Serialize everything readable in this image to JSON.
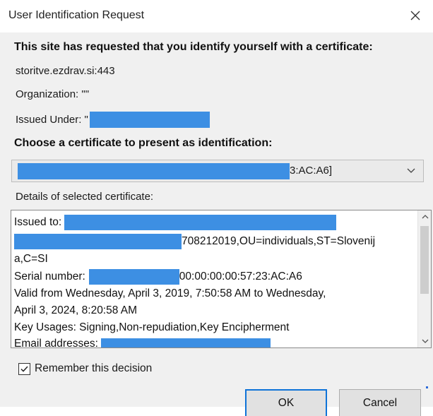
{
  "window": {
    "title": "User Identification Request",
    "close_glyph": "✕"
  },
  "header": {
    "requested_text": "This site has requested that you identify yourself with a certificate:",
    "site": "storitve.ezdrav.si:443",
    "organization_label": "Organization: \"\"",
    "issued_under_label": "Issued Under: \""
  },
  "choose": {
    "label": "Choose a certificate to present as identification:",
    "selected_suffix": "3:AC:A6]"
  },
  "details": {
    "label": "Details of selected certificate:",
    "issued_to_label": "Issued to:",
    "line2_suffix": "708212019,OU=individuals,ST=Slovenij",
    "line3": "a,C=SI",
    "serial_label": "Serial number:",
    "serial_suffix": "00:00:00:00:57:23:AC:A6",
    "valid_line1": "Valid from Wednesday, April 3, 2019, 7:50:58 AM to Wednesday,",
    "valid_line2": "April 3, 2024, 8:20:58 AM",
    "key_usages": "Key Usages: Signing,Non-repudiation,Key Encipherment",
    "email_label": "Email addresses:"
  },
  "remember": {
    "label": "Remember this decision",
    "checked": true
  },
  "buttons": {
    "ok": "OK",
    "cancel": "Cancel"
  },
  "colors": {
    "redaction": "#3d8fe3",
    "focus_border": "#0f73d8"
  }
}
